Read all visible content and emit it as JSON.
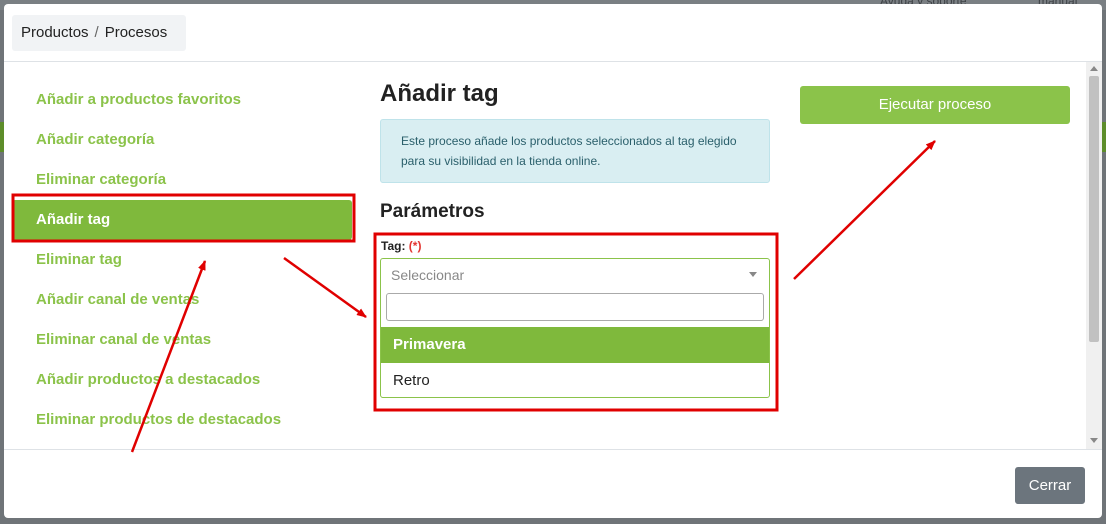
{
  "background": {
    "ghost_toolbar": [
      "Ayuda y soporte",
      "manual"
    ]
  },
  "breadcrumb": {
    "section": "Productos",
    "separator": "/",
    "current": "Procesos"
  },
  "processes": [
    {
      "label": "Añadir a productos favoritos",
      "active": false
    },
    {
      "label": "Añadir categoría",
      "active": false
    },
    {
      "label": "Eliminar categoría",
      "active": false
    },
    {
      "label": "Añadir tag",
      "active": true
    },
    {
      "label": "Eliminar tag",
      "active": false
    },
    {
      "label": "Añadir canal de ventas",
      "active": false
    },
    {
      "label": "Eliminar canal de ventas",
      "active": false
    },
    {
      "label": "Añadir productos a destacados",
      "active": false
    },
    {
      "label": "Eliminar productos de destacados",
      "active": false
    }
  ],
  "detail": {
    "title": "Añadir tag",
    "info": "Este proceso añade los productos seleccionados al tag elegido para su visibilidad en la tienda online.",
    "params_title": "Parámetros",
    "tag_label": "Tag:",
    "required_mark": "(*)",
    "select_placeholder": "Seleccionar",
    "search_value": "",
    "options": [
      {
        "label": "Primavera",
        "highlighted": true
      },
      {
        "label": "Retro",
        "highlighted": false
      }
    ]
  },
  "actions": {
    "run": "Ejecutar proceso",
    "close": "Cerrar"
  },
  "colors": {
    "accent": "#8bc34a",
    "active_bg": "#7fb93c",
    "annotation": "#e00000",
    "info_bg": "#d9eef2",
    "close_btn": "#6c757d"
  }
}
